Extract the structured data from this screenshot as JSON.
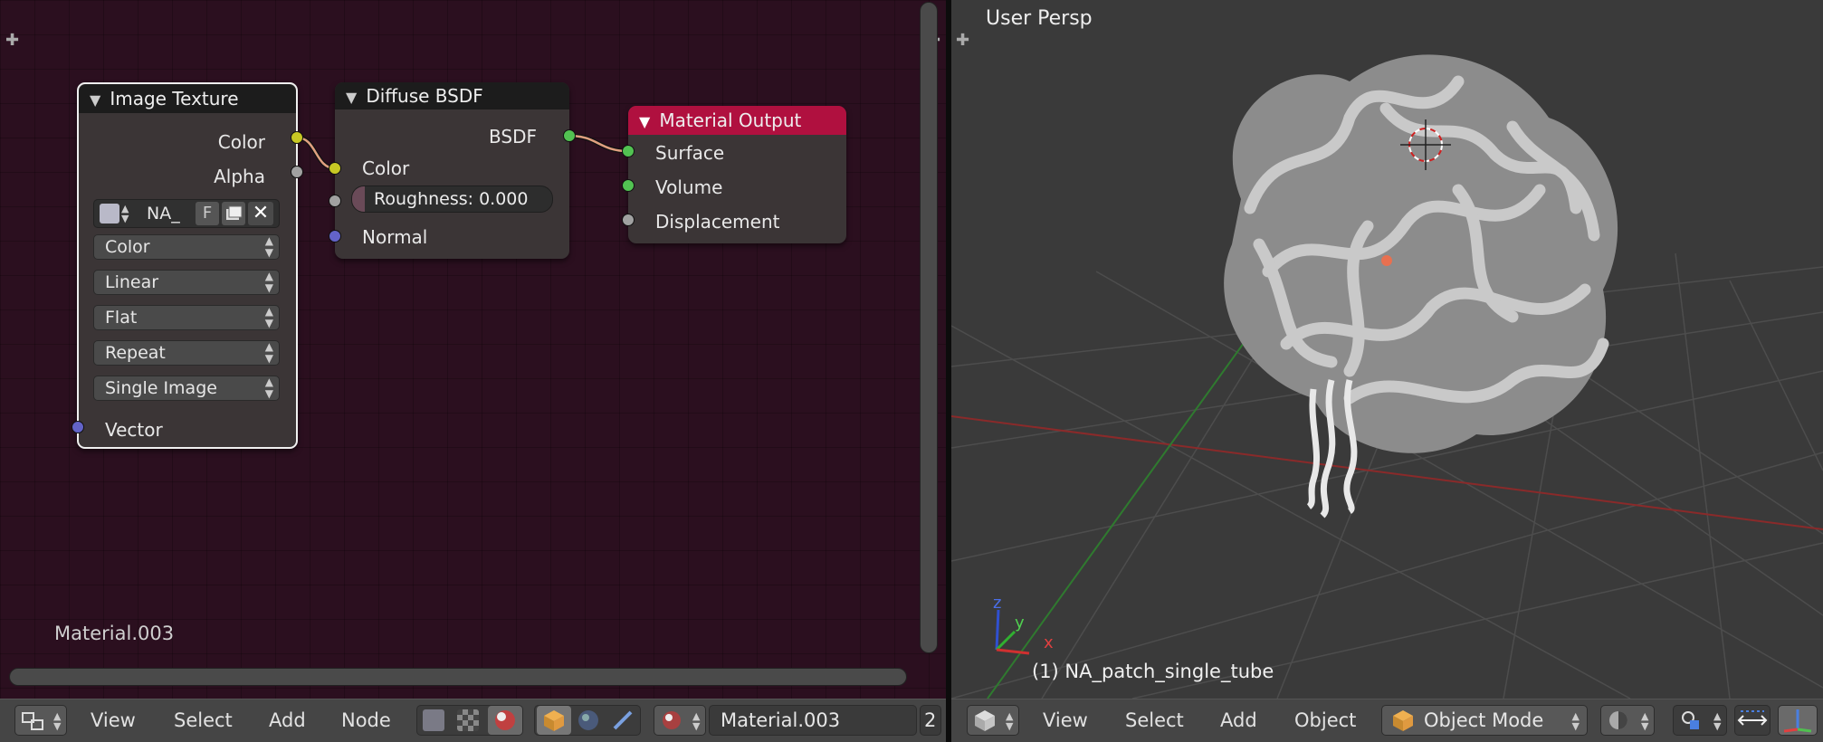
{
  "node_editor": {
    "material_label": "Material.003",
    "image_texture": {
      "title": "Image Texture",
      "outputs": {
        "color": "Color",
        "alpha": "Alpha"
      },
      "image_name": "NA_",
      "fake_user": "F",
      "dropdowns": [
        "Color",
        "Linear",
        "Flat",
        "Repeat",
        "Single Image"
      ],
      "vector": "Vector"
    },
    "diffuse": {
      "title": "Diffuse BSDF",
      "bsdf": "BSDF",
      "color": "Color",
      "roughness": "Roughness: 0.000",
      "normal": "Normal"
    },
    "output": {
      "title": "Material Output",
      "surface": "Surface",
      "volume": "Volume",
      "displacement": "Displacement"
    }
  },
  "viewport": {
    "view_label": "User Persp",
    "object_label": "(1) NA_patch_single_tube",
    "axis": {
      "x": "x",
      "y": "y",
      "z": "z"
    }
  },
  "header_left": {
    "menus": [
      "View",
      "Select",
      "Add",
      "Node"
    ],
    "material_field": "Material.003",
    "users": "2"
  },
  "header_right": {
    "menus": [
      "View",
      "Select",
      "Add",
      "Object"
    ],
    "mode": "Object Mode"
  },
  "colors": {
    "node_bg": "#2b0f1f",
    "output_header": "#b0103f",
    "link": "#e0a080"
  }
}
